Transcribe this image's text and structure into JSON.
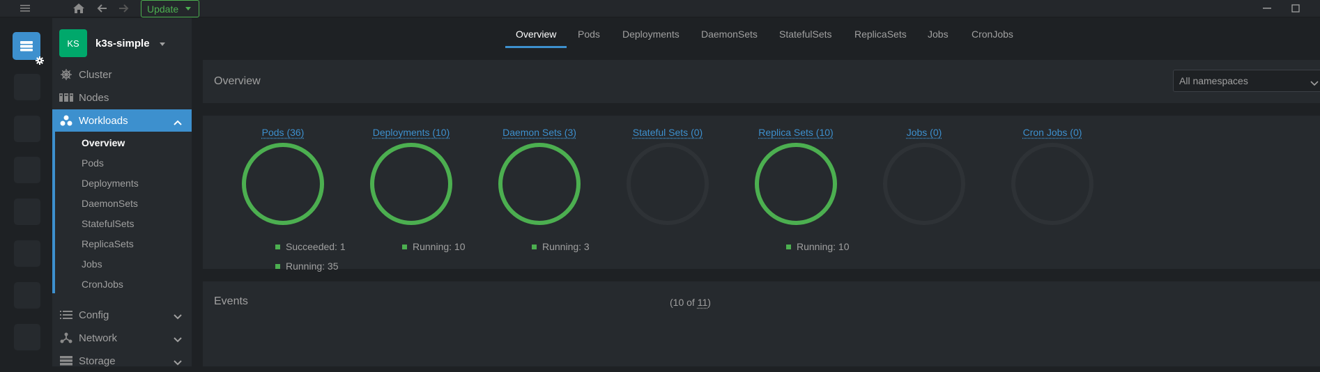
{
  "topbar": {
    "update_label": "Update",
    "accent": "#4caf50"
  },
  "cluster": {
    "initials": "KS",
    "name": "k3s-simple",
    "avatar_color": "#00a86b"
  },
  "sidebar": {
    "items": [
      {
        "label": "Cluster",
        "icon": "helm-icon"
      },
      {
        "label": "Nodes",
        "icon": "nodes-icon"
      },
      {
        "label": "Workloads",
        "icon": "workloads-icon",
        "active": true
      },
      {
        "label": "Config",
        "icon": "list-icon"
      },
      {
        "label": "Network",
        "icon": "network-icon"
      },
      {
        "label": "Storage",
        "icon": "storage-icon"
      }
    ],
    "workloads_sub": [
      "Overview",
      "Pods",
      "Deployments",
      "DaemonSets",
      "StatefulSets",
      "ReplicaSets",
      "Jobs",
      "CronJobs"
    ]
  },
  "tabs": [
    "Overview",
    "Pods",
    "Deployments",
    "DaemonSets",
    "StatefulSets",
    "ReplicaSets",
    "Jobs",
    "CronJobs"
  ],
  "overview": {
    "title": "Overview",
    "namespace_select": "All namespaces"
  },
  "stats": [
    {
      "label": "Pods (36)",
      "active": true,
      "legend": [
        "Succeeded: 1",
        "Running: 35"
      ]
    },
    {
      "label": "Deployments (10)",
      "active": true,
      "legend": [
        "Running: 10"
      ]
    },
    {
      "label": "Daemon Sets (3)",
      "active": true,
      "legend": [
        "Running: 3"
      ]
    },
    {
      "label": "Stateful Sets (0)",
      "active": false,
      "legend": []
    },
    {
      "label": "Replica Sets (10)",
      "active": true,
      "legend": [
        "Running: 10"
      ]
    },
    {
      "label": "Jobs (0)",
      "active": false,
      "legend": []
    },
    {
      "label": "Cron Jobs (0)",
      "active": false,
      "legend": []
    }
  ],
  "events": {
    "title": "Events",
    "count_prefix": "(10 of ",
    "count_total": "11",
    "count_suffix": ")"
  },
  "colors": {
    "accent_blue": "#3d90ce",
    "ring_green": "#4caf50",
    "ring_empty": "#2e3236"
  }
}
